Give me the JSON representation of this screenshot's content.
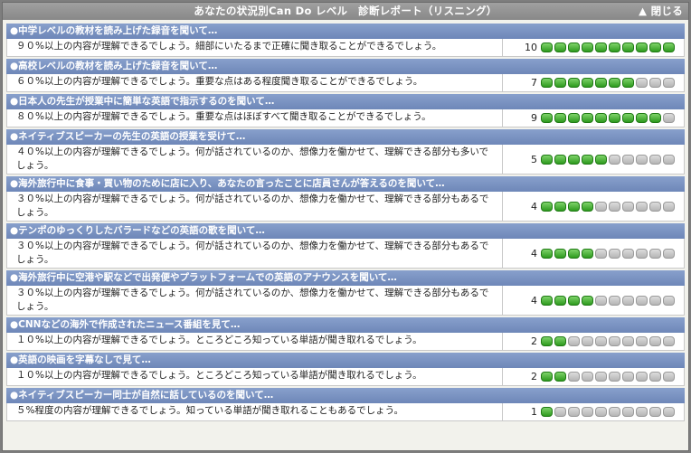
{
  "window": {
    "title": "あなたの状況別Can Do レベル　診断レポート（リスニング）",
    "close_label": "▲ 閉じる"
  },
  "max_level": 10,
  "colors": {
    "active_block": "#3aa52a",
    "inactive_block": "#c8c8c8",
    "header_bg": "#7b93c3"
  },
  "items": [
    {
      "header": "●中学レベルの教材を読み上げた録音を聞いて…",
      "description": "９０%以上の内容が理解できるでしょう。細部にいたるまで正確に聞き取ることができるでしょう。",
      "level": 10
    },
    {
      "header": "●高校レベルの教材を読み上げた録音を聞いて…",
      "description": "６０%以上の内容が理解できるでしょう。重要な点はある程度聞き取ることができるでしょう。",
      "level": 7
    },
    {
      "header": "●日本人の先生が授業中に簡単な英語で指示するのを聞いて…",
      "description": "８０%以上の内容が理解できるでしょう。重要な点はほぼすべて聞き取ることができるでしょう。",
      "level": 9
    },
    {
      "header": "●ネイティブスピーカーの先生の英語の授業を受けて…",
      "description": "４０%以上の内容が理解できるでしょう。何が話されているのか、想像力を働かせて、理解できる部分も多いでしょう。",
      "level": 5
    },
    {
      "header": "●海外旅行中に食事・買い物のために店に入り、あなたの言ったことに店員さんが答えるのを聞いて…",
      "description": "３０%以上の内容が理解できるでしょう。何が話されているのか、想像力を働かせて、理解できる部分もあるでしょう。",
      "level": 4
    },
    {
      "header": "●テンポのゆっくりしたバラードなどの英語の歌を聞いて…",
      "description": "３０%以上の内容が理解できるでしょう。何が話されているのか、想像力を働かせて、理解できる部分もあるでしょう。",
      "level": 4
    },
    {
      "header": "●海外旅行中に空港や駅などで出発便やプラットフォームでの英語のアナウンスを聞いて…",
      "description": "３０%以上の内容が理解できるでしょう。何が話されているのか、想像力を働かせて、理解できる部分もあるでしょう。",
      "level": 4
    },
    {
      "header": "●CNNなどの海外で作成されたニュース番組を見て…",
      "description": "１０%以上の内容が理解できるでしょう。ところどころ知っている単語が聞き取れるでしょう。",
      "level": 2
    },
    {
      "header": "●英語の映画を字幕なしで見て…",
      "description": "１０%以上の内容が理解できるでしょう。ところどころ知っている単語が聞き取れるでしょう。",
      "level": 2
    },
    {
      "header": "●ネイティブスピーカー同士が自然に話しているのを聞いて…",
      "description": "５%程度の内容が理解できるでしょう。知っている単語が聞き取れることもあるでしょう。",
      "level": 1
    }
  ]
}
